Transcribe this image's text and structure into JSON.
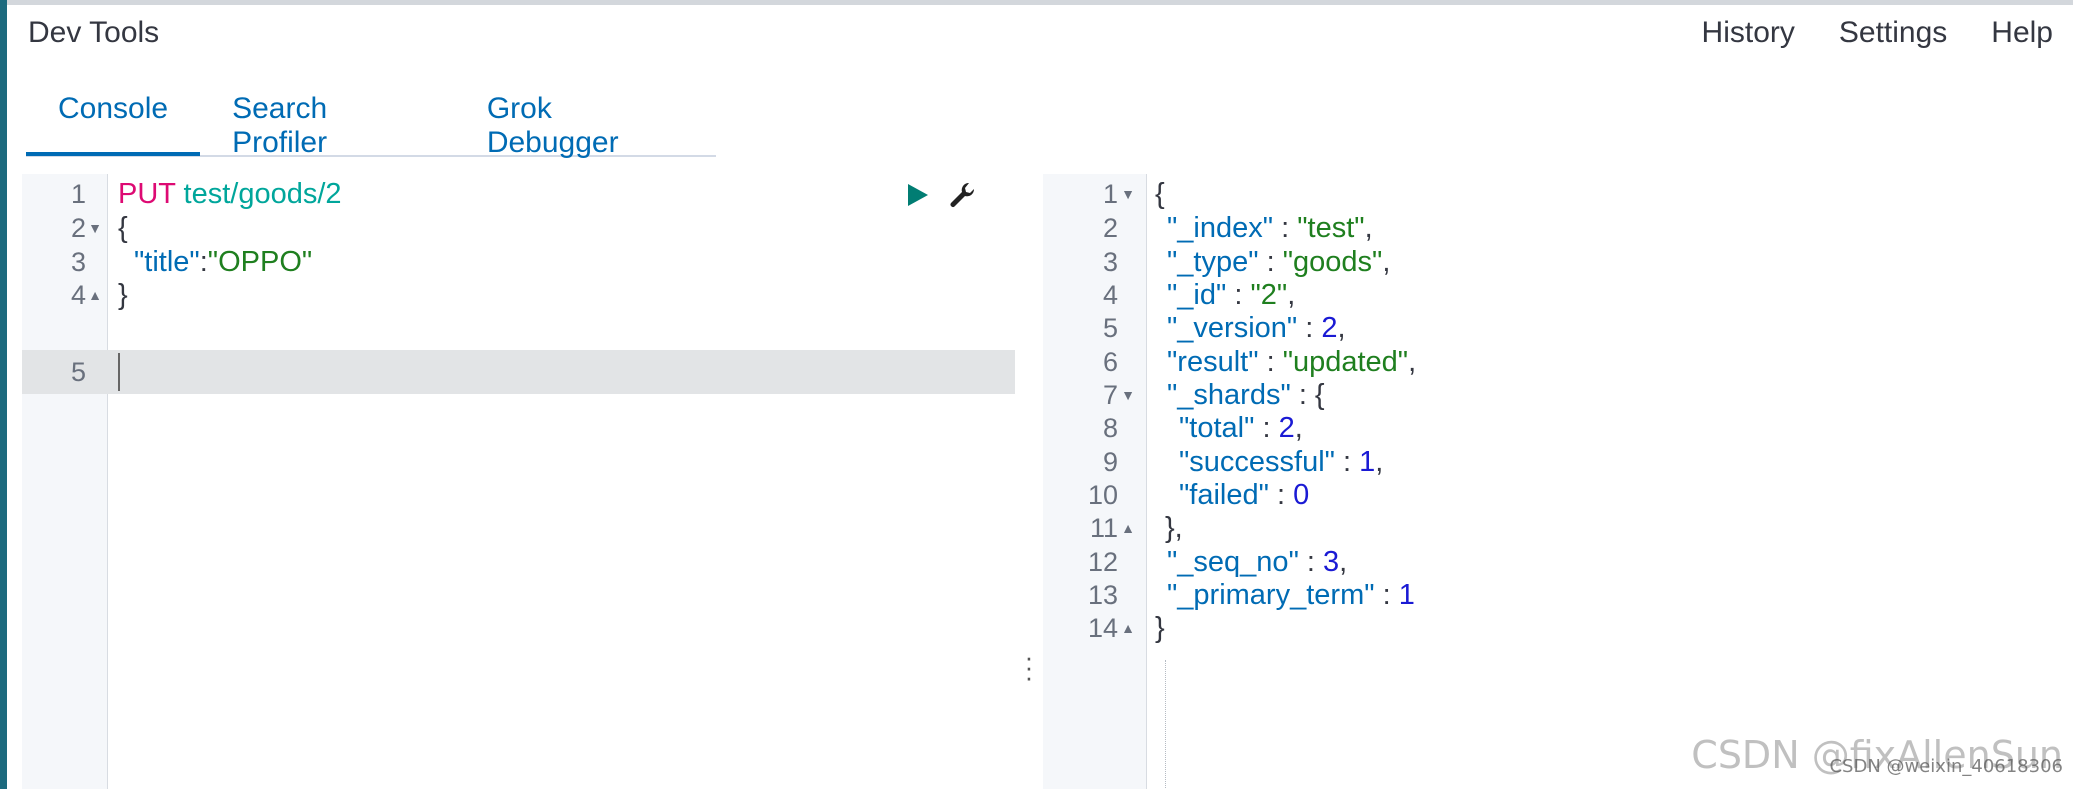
{
  "app": {
    "title": "Dev Tools"
  },
  "top_menu": [
    {
      "label": "History"
    },
    {
      "label": "Settings"
    },
    {
      "label": "Help"
    }
  ],
  "tabs": [
    {
      "label": "Console",
      "active": true
    },
    {
      "label": "Search Profiler",
      "active": false
    },
    {
      "label": "Grok Debugger",
      "active": false
    }
  ],
  "request": {
    "method": "PUT",
    "url": "test/goods/2",
    "line_numbers": [
      "1",
      "2",
      "3",
      "4",
      "5"
    ],
    "line2": "{",
    "title_key": "\"title\"",
    "colon": ":",
    "title_value": "\"OPPO\"",
    "line4": "}"
  },
  "response": {
    "line_numbers": [
      "1",
      "2",
      "3",
      "4",
      "5",
      "6",
      "7",
      "8",
      "9",
      "10",
      "11",
      "12",
      "13",
      "14"
    ],
    "open_brace": "{",
    "close_brace": "}",
    "shards_close": "},",
    "fields": {
      "index_key": "\"_index\"",
      "index_val": "\"test\"",
      "type_key": "\"_type\"",
      "type_val": "\"goods\"",
      "id_key": "\"_id\"",
      "id_val": "\"2\"",
      "version_key": "\"_version\"",
      "version_val": "2",
      "result_key": "\"result\"",
      "result_val": "\"updated\"",
      "shards_key": "\"_shards\"",
      "total_key": "\"total\"",
      "total_val": "2",
      "successful_key": "\"successful\"",
      "successful_val": "1",
      "failed_key": "\"failed\"",
      "failed_val": "0",
      "seq_no_key": "\"_seq_no\"",
      "seq_no_val": "3",
      "primary_term_key": "\"_primary_term\"",
      "primary_term_val": "1"
    }
  },
  "watermark": {
    "main": "CSDN @fixAllenSun",
    "sub": "CSDN @weixin_40618306"
  },
  "colors": {
    "accent": "#006bb4",
    "method": "#dd0a73",
    "url": "#00a69b",
    "string": "#1f7f1f",
    "number": "#1a1ad4"
  }
}
